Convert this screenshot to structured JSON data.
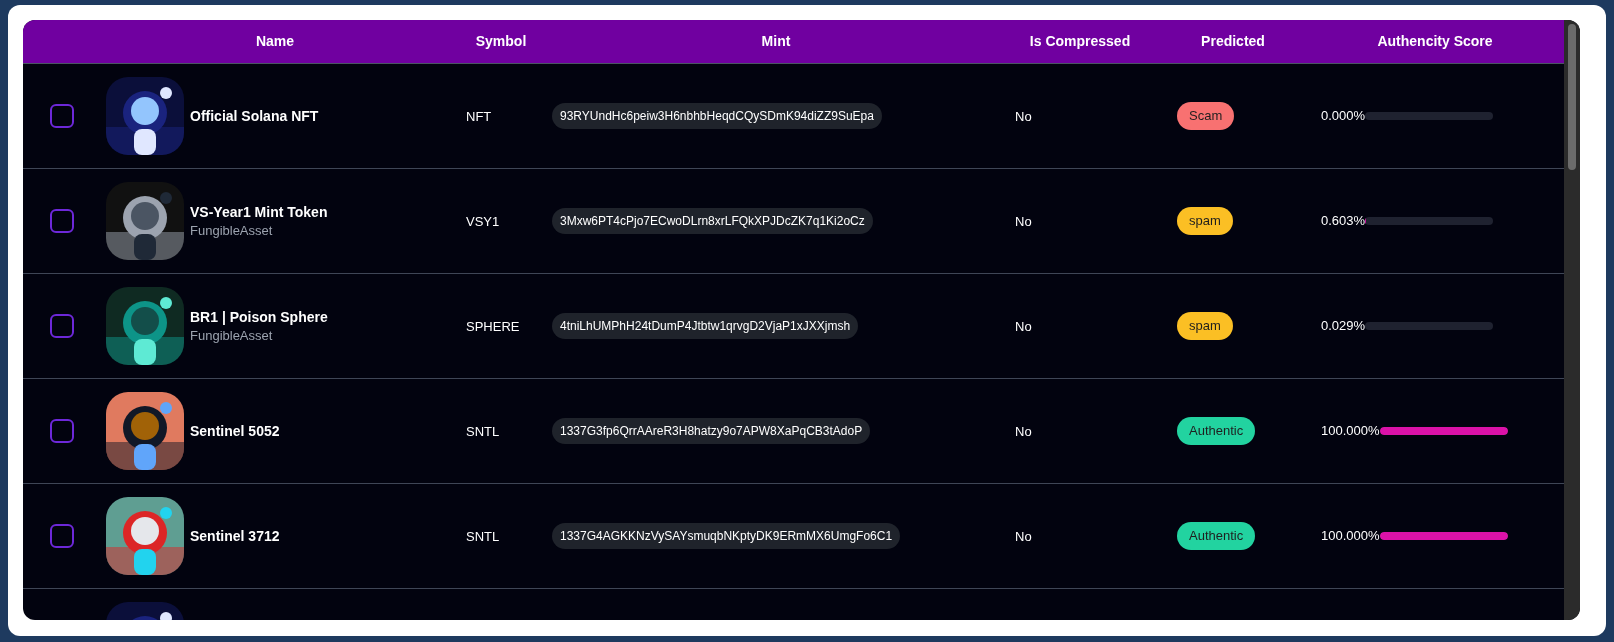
{
  "table": {
    "columns": [
      "Name",
      "Symbol",
      "Mint",
      "Is Compressed",
      "Predicted",
      "Authencity Score"
    ],
    "rows": [
      {
        "checked": false,
        "name": "Official Solana NFT",
        "symbol": "NFT",
        "mint": "93RYUndHc6peiw3H6nbhbHeqdCQySDmK94diZZ9SuEpa",
        "compressed": "No",
        "predicted": {
          "label": "Scam",
          "color": "#f87171"
        },
        "score": "0.000%",
        "level": 0
      },
      {
        "checked": false,
        "name": "VS-Year1 Mint Token",
        "subtitle": "FungibleAsset",
        "symbol": "VSY1",
        "mint": "3Mxw6PT4cPjo7ECwoDLrn8xrLFQkXPJDcZK7q1Ki2oCz",
        "compressed": "No",
        "predicted": {
          "label": "spam",
          "color": "#fbbf24"
        },
        "score": "0.603%",
        "level": 0.00603
      },
      {
        "checked": false,
        "name": "BR1 | Poison Sphere",
        "subtitle": "FungibleAsset",
        "symbol": "SPHERE",
        "mint": "4tniLhUMPhH24tDumP4Jtbtw1qrvgD2VjaP1xJXXjmsh",
        "compressed": "No",
        "predicted": {
          "label": "spam",
          "color": "#fbbf24"
        },
        "score": "0.029%",
        "level": 0.00029
      },
      {
        "checked": false,
        "name": "Sentinel 5052",
        "symbol": "SNTL",
        "mint": "1337G3fp6QrrAAreR3H8hatzy9o7APW8XaPqCB3tAdoP",
        "compressed": "No",
        "predicted": {
          "label": "Authentic",
          "color": "#22d3a0"
        },
        "score": "100.000%",
        "level": 1
      },
      {
        "checked": false,
        "name": "Sentinel 3712",
        "symbol": "SNTL",
        "mint": "1337G4AGKKNzVySAYsmuqbNKptyDK9ERmMX6UmgFo6C1",
        "compressed": "No",
        "predicted": {
          "label": "Authentic",
          "color": "#22d3a0"
        },
        "score": "100.000%",
        "level": 1
      }
    ]
  }
}
